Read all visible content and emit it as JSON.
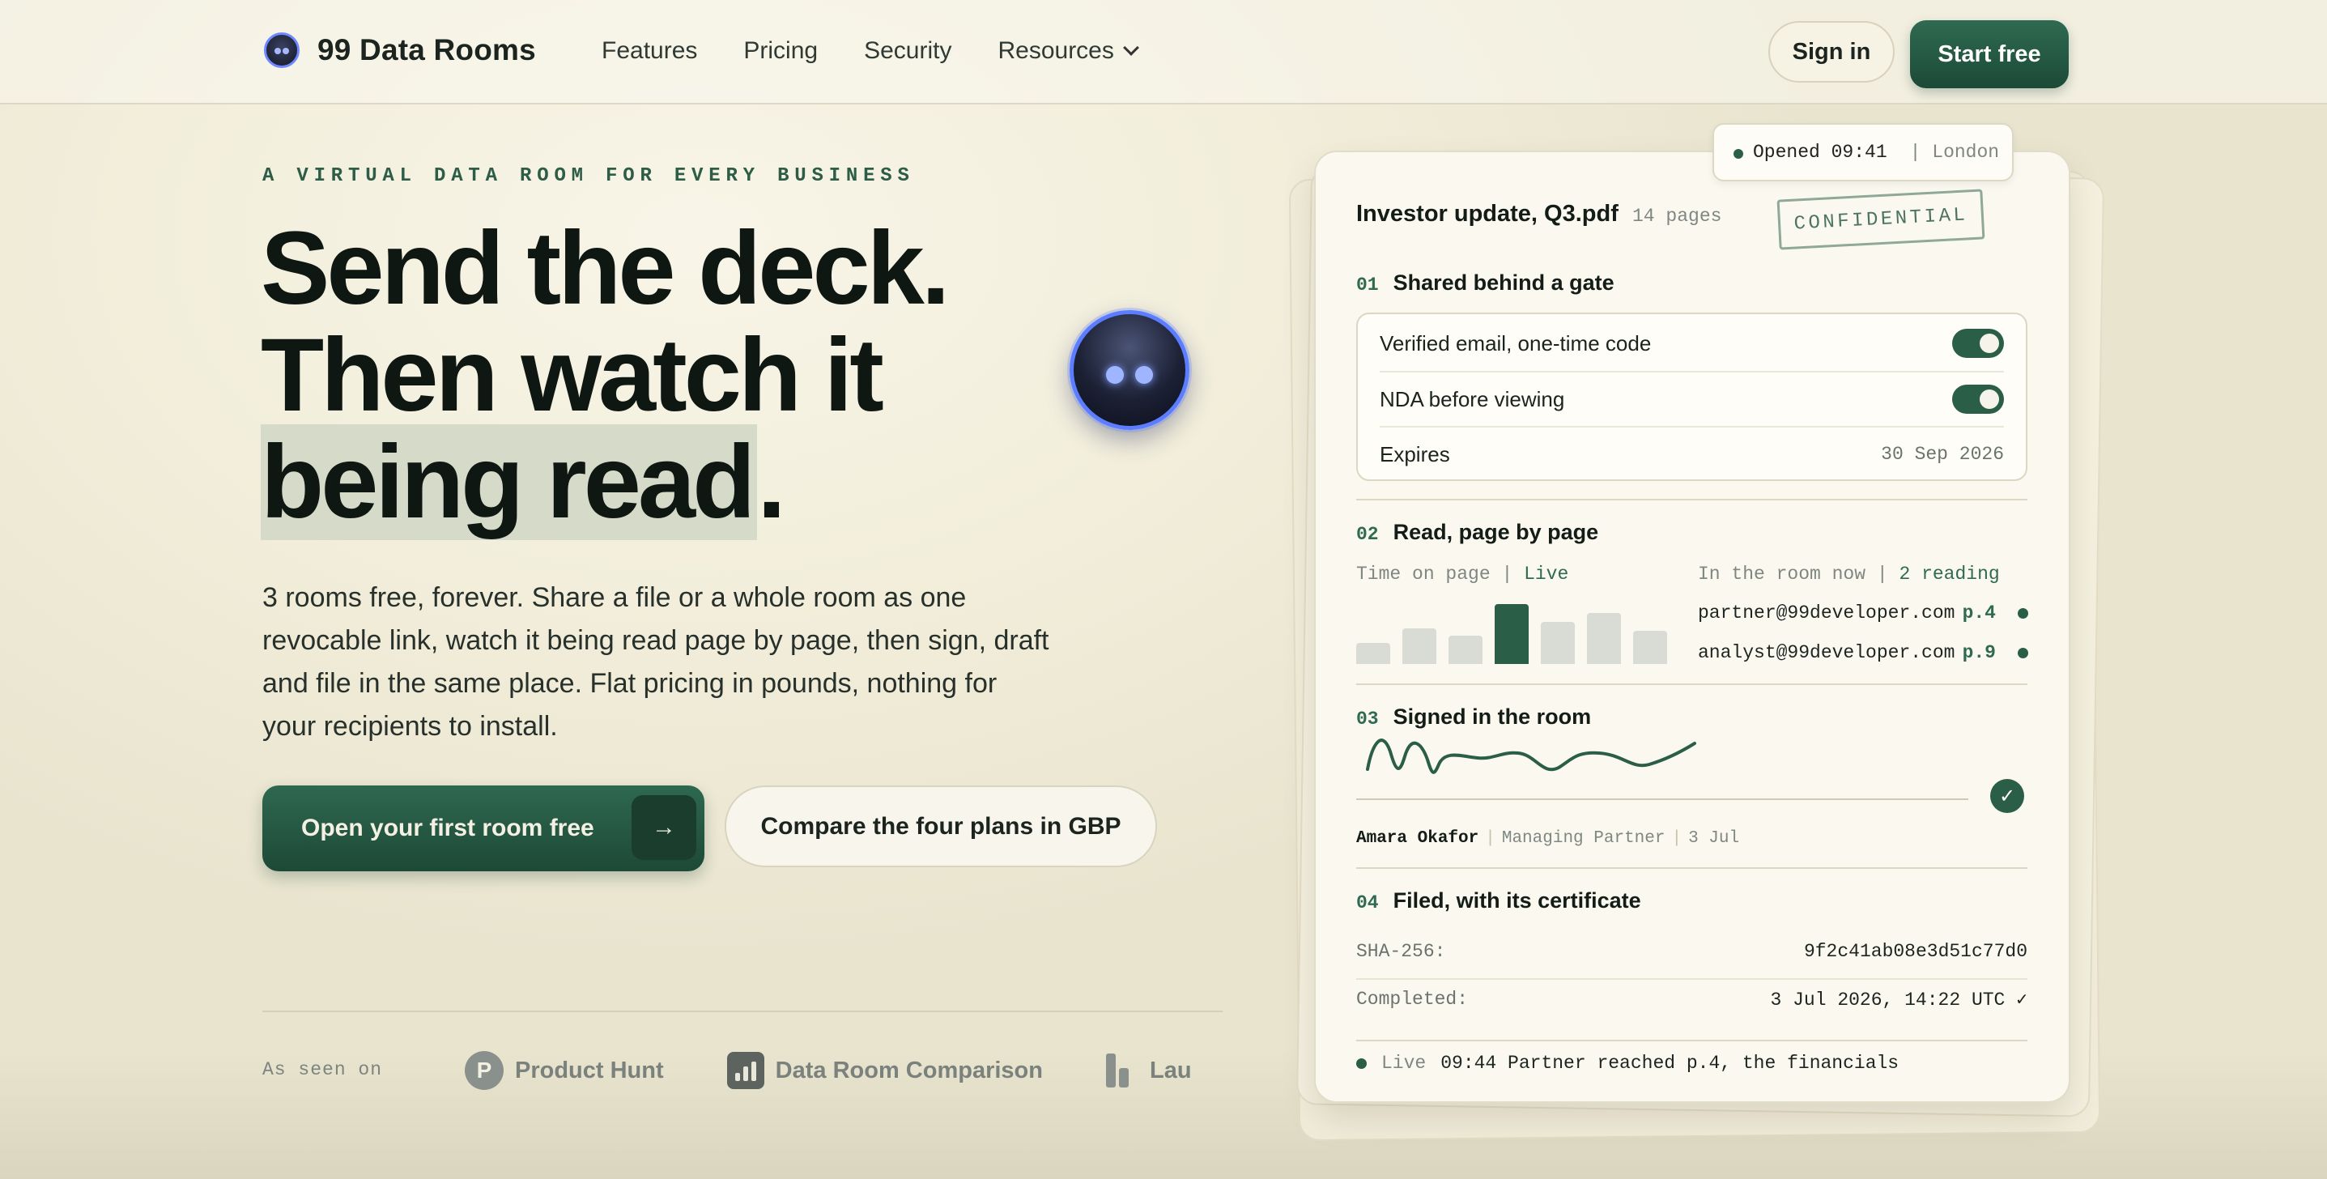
{
  "nav": {
    "brand": "99 Data Rooms",
    "links": [
      "Features",
      "Pricing",
      "Security",
      "Resources"
    ],
    "sign_in": "Sign in",
    "start_free": "Start free"
  },
  "hero": {
    "eyebrow": "A VIRTUAL DATA ROOM FOR EVERY BUSINESS",
    "headline_1": "Send the deck.",
    "headline_2": "Then watch it",
    "headline_3": "being read",
    "headline_3_end": ".",
    "lead": "3 rooms free, forever. Share a file or a whole room as one revocable link, watch it being read page by page, then sign, draft and file in the same place. Flat pricing in pounds, nothing for your recipients to install.",
    "cta_primary": "Open your first room free",
    "cta_primary_icon": "arrow-right-icon",
    "cta_secondary": "Compare the four plans in GBP",
    "as_seen_on": "As seen on",
    "press": [
      {
        "name": "Product Hunt",
        "icon": "product-hunt-icon",
        "badge": "P"
      },
      {
        "name": "Data Room Comparison",
        "icon": "data-room-comparison-icon"
      },
      {
        "name": "Lau",
        "icon": "launch-icon"
      }
    ]
  },
  "card": {
    "opened_time": "Opened 09:41",
    "opened_sep": "|",
    "opened_city": "London",
    "title": "Investor update, Q3.pdf",
    "pages": "14 pages",
    "stamp": "CONFIDENTIAL",
    "sec1_num": "01",
    "sec1_title": "Shared behind a gate",
    "gate": [
      {
        "label": "Verified email, one-time code",
        "on": true
      },
      {
        "label": "NDA before viewing",
        "on": true
      }
    ],
    "expires_label": "Expires",
    "expires_value": "30 Sep 2026",
    "sec2_num": "02",
    "sec2_title": "Read, page by page",
    "time_on_page": "Time on page",
    "live_word": "Live",
    "time_on_page_bars": [
      0.35,
      0.6,
      0.48,
      1.0,
      0.7,
      0.86,
      0.56
    ],
    "time_on_page_active_index": 3,
    "in_room": "In the room now",
    "reading": "2 reading",
    "readers": [
      {
        "email": "partner@99developer.com",
        "page": "p.4"
      },
      {
        "email": "analyst@99developer.com",
        "page": "p.9"
      }
    ],
    "sec3_num": "03",
    "sec3_title": "Signed in the room",
    "signer_name": "Amara Okafor",
    "signer_role": "Managing Partner",
    "signer_date": "3 Jul",
    "sec4_num": "04",
    "sec4_title": "Filed, with its certificate",
    "sha_label": "SHA-256:",
    "sha_value": "9f2c41ab08e3d51c77d0",
    "completed_label": "Completed:",
    "completed_value": "3 Jul 2026, 14:22 UTC ✓",
    "live_label": "Live",
    "live_event": "09:44 Partner reached p.4, the financials"
  },
  "colors": {
    "accent": "#2b5e46",
    "orb_ring": "#5c7dff"
  }
}
